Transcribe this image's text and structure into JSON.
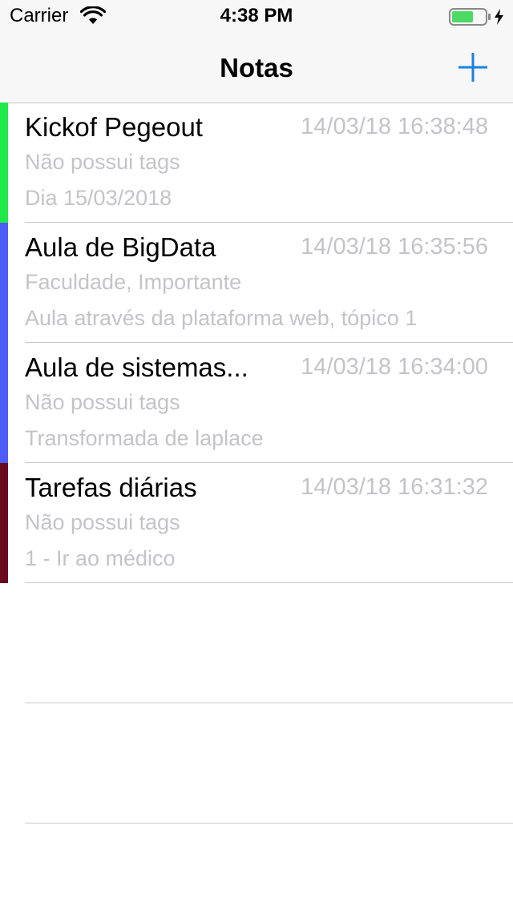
{
  "status_bar": {
    "carrier": "Carrier",
    "time": "4:38 PM",
    "icons": [
      "wifi-icon",
      "battery-icon",
      "charging-bolt-icon"
    ]
  },
  "nav": {
    "title": "Notas",
    "add_icon": "plus-icon",
    "tint_color": "#1a82e2"
  },
  "notes": [
    {
      "title": "Kickof Pegeout",
      "date": "14/03/18 16:38:48",
      "tags": "Não possui tags",
      "body": "Dia 15/03/2018",
      "color": "#1fe84a"
    },
    {
      "title": "Aula de BigData",
      "date": "14/03/18 16:35:56",
      "tags": "Faculdade, Importante",
      "body": "Aula através da plataforma web, tópico 1",
      "color": "#4e5cf6"
    },
    {
      "title": "Aula de sistemas...",
      "date": "14/03/18 16:34:00",
      "tags": "Não possui tags",
      "body": "Transformada de laplace",
      "color": "#4e5cf6"
    },
    {
      "title": "Tarefas diárias",
      "date": "14/03/18 16:31:32",
      "tags": "Não possui tags",
      "body": "1 - Ir ao médico",
      "color": "#6b0a1e"
    }
  ]
}
